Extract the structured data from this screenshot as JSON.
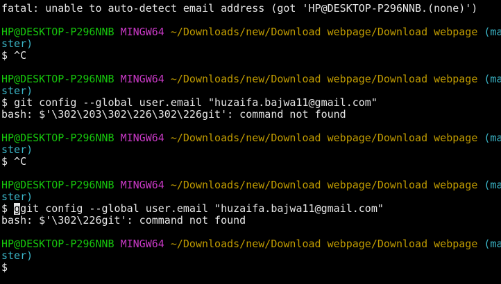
{
  "terminal": {
    "lines": [
      {
        "type": "output",
        "text": "fatal: unable to auto-detect email address (got 'HP@DESKTOP-P296NNB.(none)')"
      },
      {
        "type": "blank"
      },
      {
        "type": "prompt",
        "user": "HP@DESKTOP-P296NNB",
        "shell": "MINGW64",
        "path": "~/Downloads/new/Download webpage/Download webpage",
        "branch_head": "(ma",
        "branch_tail": "ster)"
      },
      {
        "type": "command",
        "text": "$ ^C"
      },
      {
        "type": "blank"
      },
      {
        "type": "prompt",
        "user": "HP@DESKTOP-P296NNB",
        "shell": "MINGW64",
        "path": "~/Downloads/new/Download webpage/Download webpage",
        "branch_head": "(ma",
        "branch_tail": "ster)"
      },
      {
        "type": "command",
        "text": "$ git config --global user.email \"huzaifa.bajwa11@gmail.com\""
      },
      {
        "type": "output",
        "text": "bash: $'\\302\\203\\302\\226\\302\\226git': command not found"
      },
      {
        "type": "blank"
      },
      {
        "type": "prompt",
        "user": "HP@DESKTOP-P296NNB",
        "shell": "MINGW64",
        "path": "~/Downloads/new/Download webpage/Download webpage",
        "branch_head": "(ma",
        "branch_tail": "ster)"
      },
      {
        "type": "command",
        "text": "$ ^C"
      },
      {
        "type": "blank"
      },
      {
        "type": "prompt",
        "user": "HP@DESKTOP-P296NNB",
        "shell": "MINGW64",
        "path": "~/Downloads/new/Download webpage/Download webpage",
        "branch_head": "(ma",
        "branch_tail": "ster)"
      },
      {
        "type": "cursor-command",
        "prefix": "$ ",
        "cursor": "g",
        "rest": "git config --global user.email \"huzaifa.bajwa11@gmail.com\""
      },
      {
        "type": "output",
        "text": "bash: $'\\302\\226git': command not found"
      },
      {
        "type": "blank"
      },
      {
        "type": "prompt",
        "user": "HP@DESKTOP-P296NNB",
        "shell": "MINGW64",
        "path": "~/Downloads/new/Download webpage/Download webpage",
        "branch_head": "(ma",
        "branch_tail": "ster)"
      },
      {
        "type": "command",
        "text": "$"
      }
    ],
    "colors": {
      "background": "#000000",
      "text": "#e6e6e6",
      "user": "#16c60c",
      "shell": "#c839c5",
      "path": "#c19c00",
      "branch": "#3bb7c9"
    }
  }
}
